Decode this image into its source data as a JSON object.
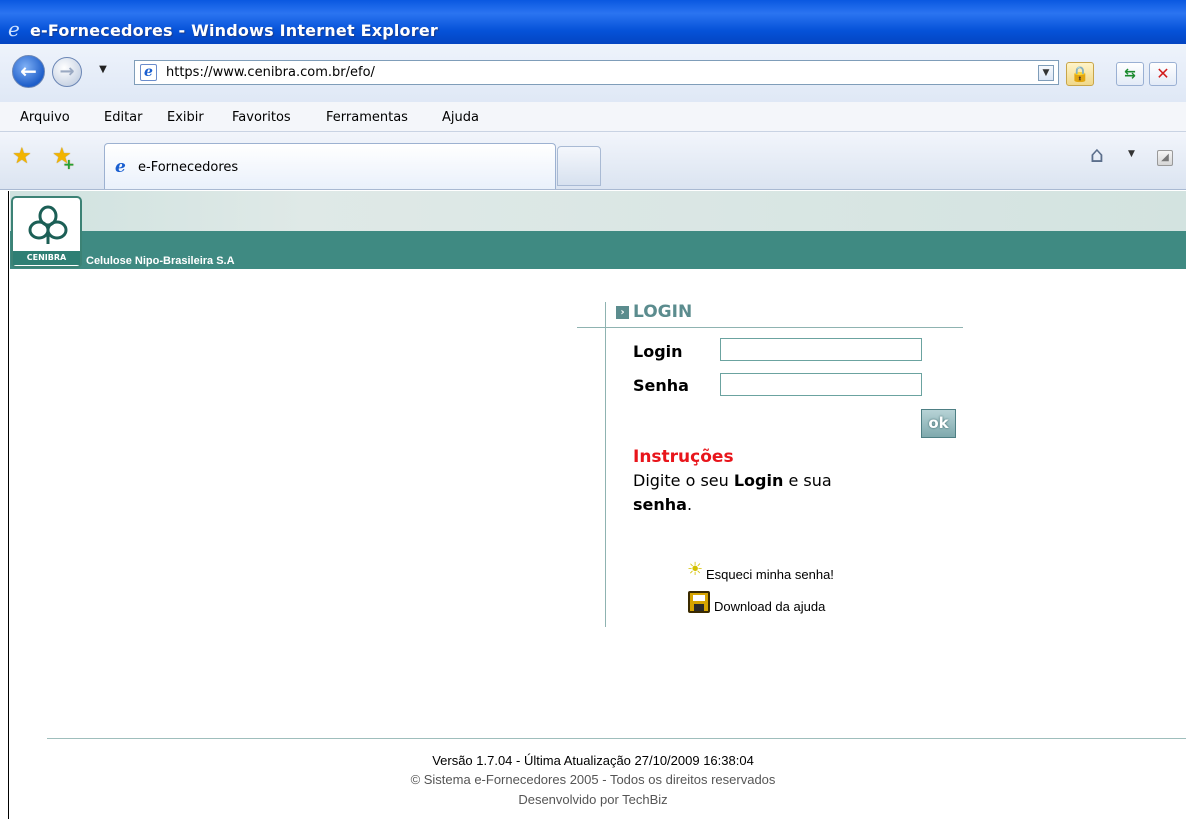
{
  "window": {
    "title": "e-Fornecedores - Windows Internet Explorer"
  },
  "address": {
    "url": "https://www.cenibra.com.br/efo/"
  },
  "menu": {
    "items": [
      "Arquivo",
      "Editar",
      "Exibir",
      "Favoritos",
      "Ferramentas",
      "Ajuda"
    ]
  },
  "tab": {
    "label": "e-Fornecedores"
  },
  "brand": {
    "logo_text": "CENIBRA",
    "company": "Celulose Nipo-Brasileira S.A"
  },
  "login": {
    "heading": "LOGIN",
    "login_label": "Login",
    "login_value": "",
    "password_label": "Senha",
    "password_value": "",
    "ok_label": "ok",
    "instructions_heading": "Instruções",
    "instructions_pre": "Digite o seu ",
    "instructions_bold1": "Login",
    "instructions_mid": " e sua ",
    "instructions_bold2": "senha",
    "instructions_end": ".",
    "forgot_link": "Esqueci minha senha!",
    "download_link": "Download da ajuda"
  },
  "footer": {
    "version": "Versão 1.7.04 -  Última Atualização 27/10/2009 16:38:04",
    "copyright": "© Sistema e-Fornecedores 2005 - Todos os direitos reservados",
    "developer": "Desenvolvido por TechBiz"
  },
  "colors": {
    "titlebar": "#0a58e0",
    "brand_bar": "#3f8a82",
    "login_heading": "#5b8c8e",
    "instructions_heading": "#e8151b"
  },
  "icons": [
    "ie-icon",
    "back-arrow-icon",
    "forward-arrow-icon",
    "lock-icon",
    "refresh-icon",
    "stop-icon",
    "favorites-star-icon",
    "add-favorite-icon",
    "home-icon",
    "feed-icon",
    "bullet-arrow-icon",
    "lightbulb-icon",
    "floppy-disk-icon"
  ]
}
